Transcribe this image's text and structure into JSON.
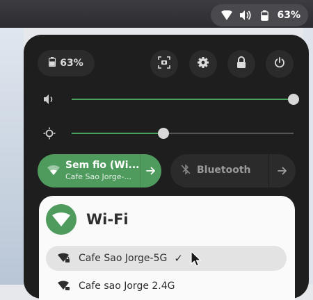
{
  "topbar": {
    "battery_percent": "63%",
    "icons": [
      "wifi-icon",
      "volume-icon",
      "battery-icon"
    ]
  },
  "quick_settings": {
    "battery_percent": "63%",
    "buttons": [
      "screenshot-icon",
      "settings-icon",
      "lock-icon",
      "power-icon"
    ],
    "sliders": {
      "volume": {
        "icon": "volume-icon",
        "value": 1.0
      },
      "brightness": {
        "icon": "brightness-icon",
        "value": 0.415
      }
    },
    "wifi_toggle": {
      "title": "Sem fio (Wi...",
      "subtitle": "Cafe Sao Jorge-...",
      "on": true
    },
    "bluetooth_toggle": {
      "title": "Bluetooth",
      "on": false
    }
  },
  "wifi_menu": {
    "title": "Wi-Fi",
    "networks": [
      {
        "name": "Cafe Sao Jorge-5G",
        "connected": true,
        "secured": true
      },
      {
        "name": "Cafe sao Jorge 2.4G",
        "connected": false,
        "secured": true
      }
    ]
  },
  "colors": {
    "accent": "#4f9b5e",
    "panel_bg": "#1e1e1e",
    "button_bg": "#2b2b2b",
    "menu_bg": "#fafafa"
  }
}
